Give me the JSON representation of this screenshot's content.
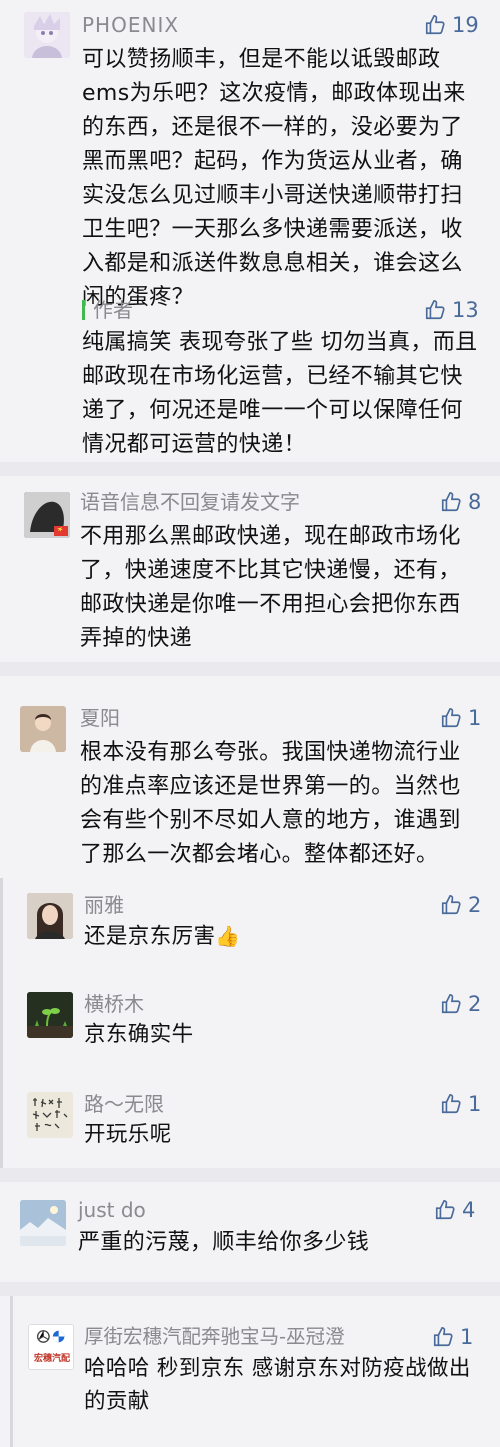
{
  "comments": [
    {
      "user": "PHOENIX",
      "likes": "19",
      "text": "可以赞扬顺丰，但是不能以诋毁邮政ems为乐吧？这次疫情，邮政体现出来的东西，还是很不一样的，没必要为了黑而黑吧？起码，作为货运从业者，确实没怎么见过顺丰小哥送快递顺带打扫卫生吧？一天那么多快递需要派送，收入都是和派送件数息息相关，谁会这么闲的蛋疼？",
      "reply": {
        "label": "作者",
        "likes": "13",
        "text": "纯属搞笑  表现夸张了些  切勿当真，而且邮政现在市场化运营，已经不输其它快递了，何况还是唯一一个可以保障任何情况都可运营的快递！"
      }
    },
    {
      "user": "语音信息不回复请发文字",
      "likes": "8",
      "text": "不用那么黑邮政快递，现在邮政市场化了，快递速度不比其它快递慢，还有，邮政快递是你唯一不用担心会把你东西弄掉的快递"
    },
    {
      "user": "夏阳",
      "likes": "1",
      "text": "根本没有那么夸张。我国快递物流行业的准点率应该还是世界第一的。当然也会有些个别不尽如人意的地方，谁遇到了那么一次都会堵心。整体都还好。",
      "replies": [
        {
          "user": "丽雅",
          "likes": "2",
          "text": "还是京东厉害",
          "emoji": "👍"
        },
        {
          "user": "横桥木",
          "likes": "2",
          "text": "京东确实牛"
        },
        {
          "user": "路～无限",
          "likes": "1",
          "text": "开玩乐呢"
        }
      ]
    },
    {
      "user": "just do",
      "likes": "4",
      "text": "严重的污蔑，顺丰给你多少钱"
    },
    {
      "user": "厚街宏穗汽配奔驰宝马-巫冠澄",
      "likes": "1",
      "text": "哈哈哈 秒到京东 感谢京东对防疫战做出的贡献",
      "avatar_text": "宏穗汽配"
    }
  ],
  "colors": {
    "like": "#4a6a99",
    "name": "#8a8a8f",
    "author_bar": "#3fb950"
  },
  "icons": {
    "like": "thumbs-up-icon"
  }
}
